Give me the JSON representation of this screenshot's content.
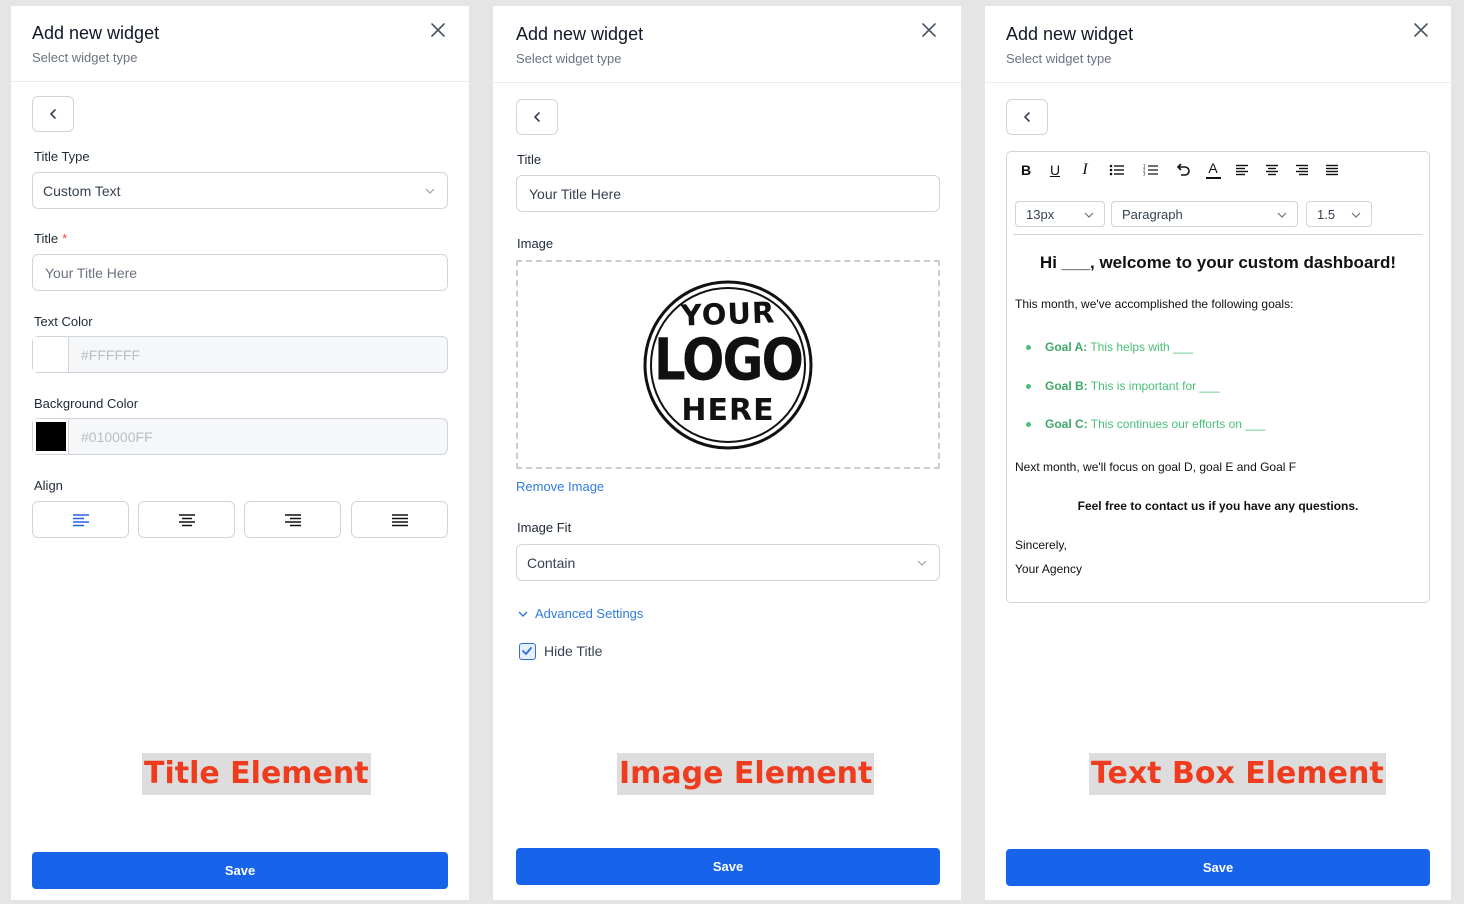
{
  "common": {
    "header_title": "Add new widget",
    "header_subtitle": "Select widget type",
    "save_label": "Save"
  },
  "panel1": {
    "title_type_label": "Title Type",
    "title_type_value": "Custom Text",
    "title_label": "Title",
    "title_required_mark": "*",
    "title_placeholder": "Your Title Here",
    "text_color_label": "Text Color",
    "text_color_value": "#FFFFFF",
    "background_color_label": "Background Color",
    "background_color_value": "#010000FF",
    "align_label": "Align",
    "align_options": [
      "align-left",
      "align-center",
      "align-right",
      "align-justify"
    ],
    "selected_align": "align-left",
    "caption": "Title Element"
  },
  "panel2": {
    "title_label": "Title",
    "title_placeholder": "Your Title Here",
    "image_label": "Image",
    "logo_text": [
      "YOUR",
      "LOGO",
      "HERE"
    ],
    "remove_image_label": "Remove Image",
    "image_fit_label": "Image Fit",
    "image_fit_value": "Contain",
    "advanced_settings_label": "Advanced Settings",
    "hide_title_label": "Hide Title",
    "hide_title_checked": true,
    "caption": "Image Element"
  },
  "panel3": {
    "toolbar": [
      "B",
      "U",
      "I",
      "bullet-list",
      "numbered-list",
      "undo",
      "A",
      "align-left",
      "align-center",
      "align-right",
      "align-justify"
    ],
    "font_size": "13px",
    "block_type": "Paragraph",
    "line_height": "1.5",
    "content": {
      "greeting": "Hi ___, welcome to your custom dashboard!",
      "intro": "This month, we've accomplished the following goals:",
      "goals": [
        {
          "label": "Goal A:",
          "text": " This helps with ___"
        },
        {
          "label": "Goal B:",
          "text": " This is important for ___"
        },
        {
          "label": "Goal C:",
          "text": " This continues our efforts on ___"
        }
      ],
      "next_month": "Next month, we'll focus on goal D, goal E and Goal F",
      "contact": "Feel free to contact us if you have any questions.",
      "sign_off": "Sincerely,",
      "signature": "Your Agency"
    },
    "caption": "Text Box Element"
  },
  "colors": {
    "accent": "#1763ea",
    "link": "#2f7be0",
    "caption_text": "#ef3b1e",
    "caption_bg": "#dddddd",
    "goal_green": "#4ac07a",
    "text_color_swatch": "#FFFFFF",
    "background_color_swatch": "#010000"
  }
}
